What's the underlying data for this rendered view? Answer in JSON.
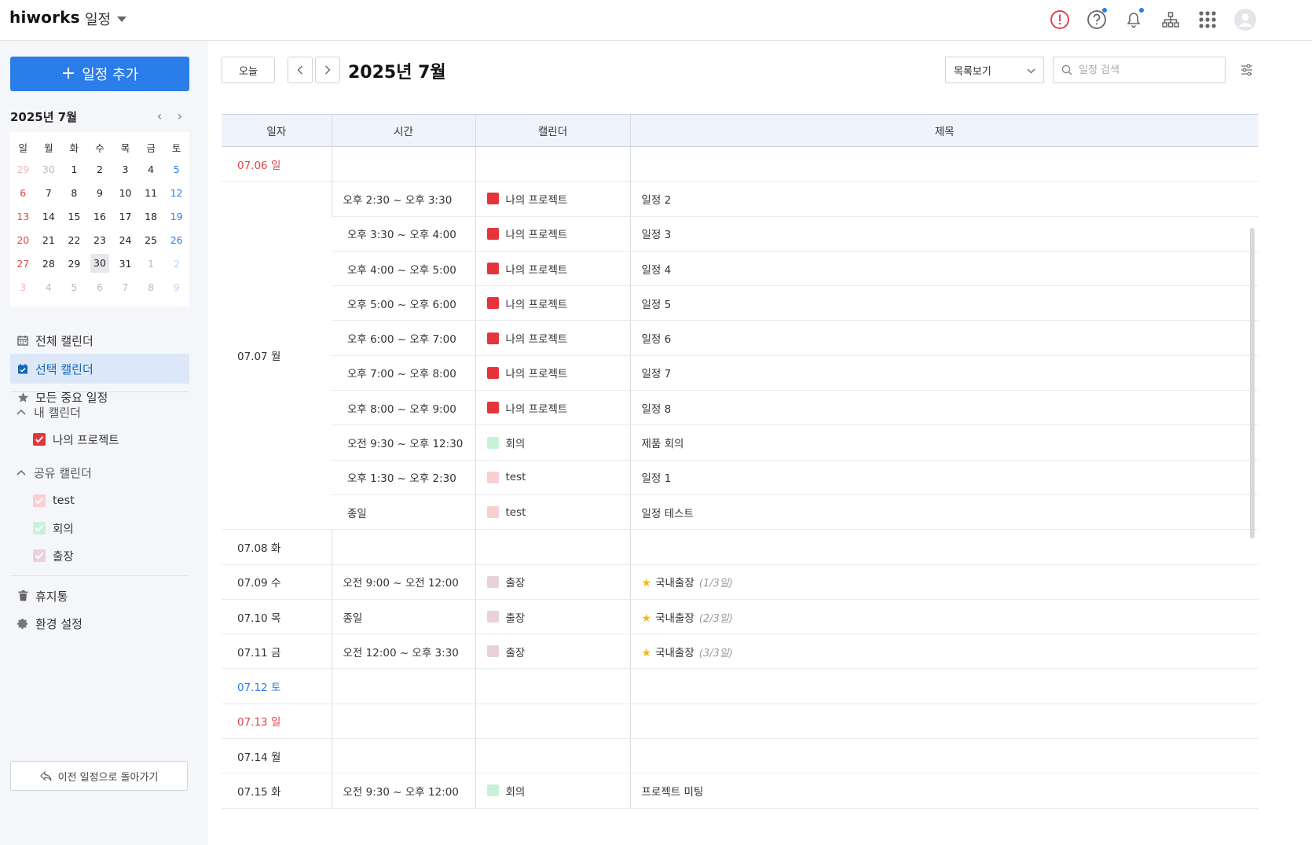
{
  "header": {
    "logo": "hiworks",
    "app_title": "일정",
    "icons": [
      "alert-icon",
      "help-icon",
      "bell-icon",
      "org-chart-icon",
      "apps-grid-icon",
      "avatar"
    ]
  },
  "sidebar": {
    "add_label": "일정 추가",
    "mini_title": "2025년 7월",
    "weekdays": [
      "일",
      "월",
      "화",
      "수",
      "목",
      "금",
      "토"
    ],
    "weeks": [
      [
        "29",
        "30",
        "1",
        "2",
        "3",
        "4",
        "5"
      ],
      [
        "6",
        "7",
        "8",
        "9",
        "10",
        "11",
        "12"
      ],
      [
        "13",
        "14",
        "15",
        "16",
        "17",
        "18",
        "19"
      ],
      [
        "20",
        "21",
        "22",
        "23",
        "24",
        "25",
        "26"
      ],
      [
        "27",
        "28",
        "29",
        "30",
        "31",
        "1",
        "2"
      ],
      [
        "3",
        "4",
        "5",
        "6",
        "7",
        "8",
        "9"
      ]
    ],
    "today": "30",
    "nav": {
      "all": "전체 캘린더",
      "selected": "선택 캘린더",
      "important": "모든 중요 일정"
    },
    "my_group": "내 캘린더",
    "my_calendars": [
      {
        "label": "나의 프로젝트",
        "color": "#e5343a"
      }
    ],
    "shared_group": "공유 캘린더",
    "shared_calendars": [
      {
        "label": "test",
        "color": "#f9cfd2"
      },
      {
        "label": "회의",
        "color": "#c8f2d7"
      },
      {
        "label": "출장",
        "color": "#e8d2d8"
      }
    ],
    "trash": "휴지통",
    "settings": "환경 설정",
    "back_label": "이전 일정으로 돌아가기"
  },
  "toolbar": {
    "today_label": "오늘",
    "month_title": "2025년 7월",
    "view_label": "목록보기",
    "search_placeholder": "일정 검색"
  },
  "table": {
    "headers": [
      "일자",
      "시간",
      "캘린더",
      "제목"
    ],
    "rows": [
      {
        "date": "07.06 일",
        "date_color": "#e0454a",
        "span": 1,
        "time": "",
        "calendar": "",
        "cal_color": "",
        "title": ""
      },
      {
        "date": "07.07 월",
        "date_color": "#333333",
        "span": 10,
        "time": "오후 2:30 ~ 오후 3:30",
        "calendar": "나의 프로젝트",
        "cal_color": "#e5343a",
        "title": "일정 2"
      },
      {
        "time": "오후 3:30 ~ 오후 4:00",
        "calendar": "나의 프로젝트",
        "cal_color": "#e5343a",
        "title": "일정 3"
      },
      {
        "time": "오후 4:00 ~ 오후 5:00",
        "calendar": "나의 프로젝트",
        "cal_color": "#e5343a",
        "title": "일정 4"
      },
      {
        "time": "오후 5:00 ~ 오후 6:00",
        "calendar": "나의 프로젝트",
        "cal_color": "#e5343a",
        "title": "일정 5"
      },
      {
        "time": "오후 6:00 ~ 오후 7:00",
        "calendar": "나의 프로젝트",
        "cal_color": "#e5343a",
        "title": "일정 6"
      },
      {
        "time": "오후 7:00 ~ 오후 8:00",
        "calendar": "나의 프로젝트",
        "cal_color": "#e5343a",
        "title": "일정 7"
      },
      {
        "time": "오후 8:00 ~ 오후 9:00",
        "calendar": "나의 프로젝트",
        "cal_color": "#e5343a",
        "title": "일정 8"
      },
      {
        "time": "오전 9:30 ~ 오후 12:30",
        "calendar": "회의",
        "cal_color": "#c8f2d7",
        "title": "제품 회의"
      },
      {
        "time": "오후 1:30 ~ 오후 2:30",
        "calendar": "test",
        "cal_color": "#f9cfd2",
        "title": "일정 1"
      },
      {
        "time": "종일",
        "calendar": "test",
        "cal_color": "#f9cfd2",
        "title": "일정 테스트"
      },
      {
        "date": "07.08 화",
        "date_color": "#333333",
        "span": 1,
        "time": "",
        "calendar": "",
        "cal_color": "",
        "title": ""
      },
      {
        "date": "07.09 수",
        "date_color": "#333333",
        "span": 1,
        "time": "오전 9:00 ~ 오전 12:00",
        "calendar": "출장",
        "cal_color": "#e8d2d8",
        "title": "국내출장",
        "star": true,
        "range": "(1/3일)"
      },
      {
        "date": "07.10 목",
        "date_color": "#333333",
        "span": 1,
        "time": "종일",
        "calendar": "출장",
        "cal_color": "#e8d2d8",
        "title": "국내출장",
        "star": true,
        "range": "(2/3일)"
      },
      {
        "date": "07.11 금",
        "date_color": "#333333",
        "span": 1,
        "time": "오전 12:00 ~ 오후 3:30",
        "calendar": "출장",
        "cal_color": "#e8d2d8",
        "title": "국내출장",
        "star": true,
        "range": "(3/3일)"
      },
      {
        "date": "07.12 토",
        "date_color": "#2b7de9",
        "span": 1,
        "time": "",
        "calendar": "",
        "cal_color": "",
        "title": ""
      },
      {
        "date": "07.13 일",
        "date_color": "#e0454a",
        "span": 1,
        "time": "",
        "calendar": "",
        "cal_color": "",
        "title": ""
      },
      {
        "date": "07.14 월",
        "date_color": "#333333",
        "span": 1,
        "time": "",
        "calendar": "",
        "cal_color": "",
        "title": ""
      },
      {
        "date": "07.15 화",
        "date_color": "#333333",
        "span": 1,
        "time": "오전 9:30 ~ 오후 12:00",
        "calendar": "회의",
        "cal_color": "#c8f2d7",
        "title": "프로젝트 미팅"
      }
    ]
  },
  "colors": {
    "accent": "#2b7de9",
    "sunday": "#e0454a",
    "saturday": "#2b7de9",
    "alert": "#e0454a"
  }
}
